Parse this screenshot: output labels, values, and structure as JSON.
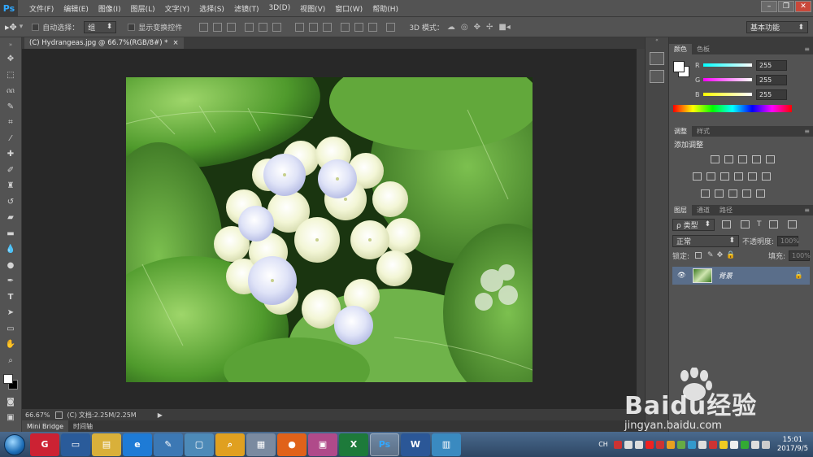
{
  "app": {
    "logo": "Ps"
  },
  "menu": [
    "文件(F)",
    "编辑(E)",
    "图像(I)",
    "图层(L)",
    "文字(Y)",
    "选择(S)",
    "滤镜(T)",
    "3D(D)",
    "视图(V)",
    "窗口(W)",
    "帮助(H)"
  ],
  "options": {
    "auto_select_label": "自动选择：",
    "auto_select_value": "组",
    "show_transform_label": "显示变换控件",
    "mode_3d_label": "3D 模式：",
    "workspace": "基本功能"
  },
  "document": {
    "tab_title": "(C) Hydrangeas.jpg @ 66.7%(RGB/8#) *",
    "close": "×"
  },
  "status": {
    "zoom": "66.67%",
    "doc_info": "(C) 文档:2.25M/2.25M"
  },
  "bottom_tabs": [
    "Mini Bridge",
    "时间轴"
  ],
  "color_panel": {
    "tabs": [
      "颜色",
      "色板"
    ],
    "channels": [
      {
        "name": "R",
        "value": "255",
        "color": "#ff0000"
      },
      {
        "name": "G",
        "value": "255",
        "color": "#00ff00"
      },
      {
        "name": "B",
        "value": "255",
        "color": "#0000ff"
      }
    ]
  },
  "adjust_panel": {
    "tabs": [
      "调整",
      "样式"
    ],
    "title": "添加调整"
  },
  "layers_panel": {
    "tabs": [
      "图层",
      "通道",
      "路径"
    ],
    "filter_label": "ρ 类型",
    "blend_mode": "正常",
    "opacity_label": "不透明度:",
    "opacity_value": "100%",
    "lock_label": "锁定:",
    "fill_label": "填充:",
    "fill_value": "100%",
    "layer_name": "背景"
  },
  "taskbar": {
    "apps": [
      "G",
      "▭",
      "▤",
      "e",
      "✎",
      "▢",
      "⌕",
      "▦",
      "●",
      "▣",
      "X",
      "Ps",
      "W",
      "▥"
    ],
    "ime": "CH",
    "time": "15:01",
    "date": "2017/9/5"
  },
  "watermark": {
    "brand": "Baidu经验",
    "url": "jingyan.baidu.com"
  }
}
